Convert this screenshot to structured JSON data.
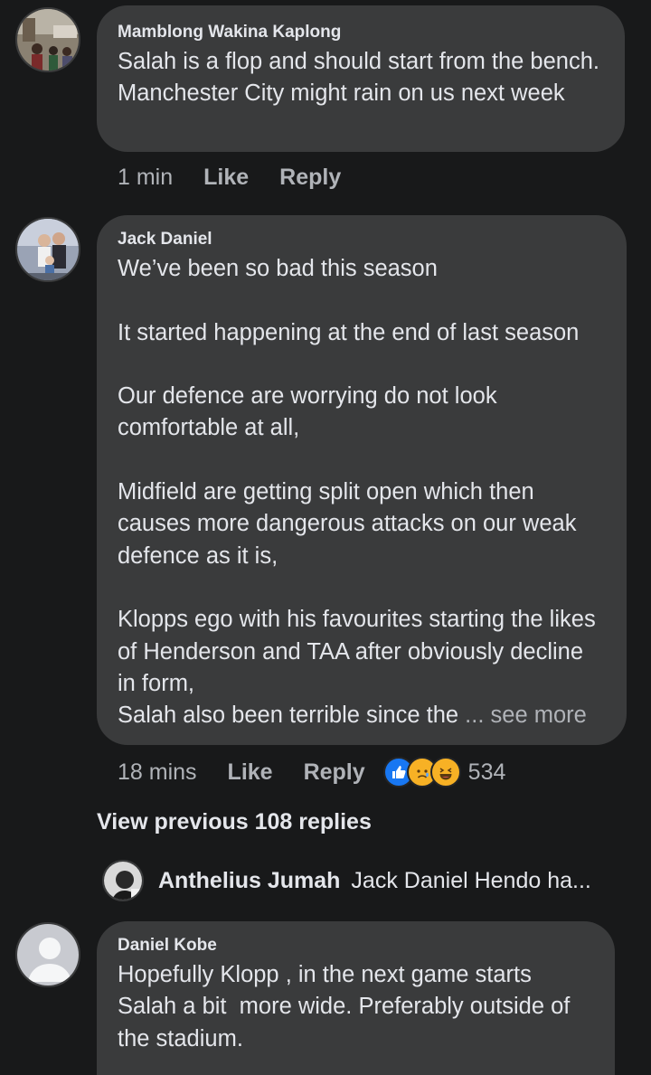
{
  "comments": [
    {
      "author": "Mamblong Wakina Kaplong",
      "text": "Salah is a flop and should start from the bench. Manchester City might rain on us next week",
      "time": "1 min",
      "like_label": "Like",
      "reply_label": "Reply"
    },
    {
      "author": "Jack Daniel",
      "text": "We’ve been so bad this season\n\nIt started happening at the end of last season\n\nOur defence are worrying do not look comfortable at all,\n\nMidfield are getting split open which then causes more dangerous attacks on our weak defence as it is,\n\nKlopps ego with his favourites starting the likes of Henderson and TAA after obviously decline in form,\nSalah also been terrible since the",
      "see_more": "... see more",
      "time": "18 mins",
      "like_label": "Like",
      "reply_label": "Reply",
      "reactions": [
        "like-icon",
        "sad-icon",
        "haha-icon"
      ],
      "reaction_count": "534"
    },
    {
      "author": "Daniel Kobe",
      "text": "Hopefully Klopp , in the next game starts Salah a bit  more wide. Preferably outside of the stadium."
    }
  ],
  "view_previous": "View previous 108 replies",
  "reply_preview": {
    "author": "Anthelius Jumah",
    "snippet": "Jack Daniel Hendo ha..."
  },
  "colors": {
    "background": "#18191a",
    "bubble": "#3a3b3c",
    "text": "#e4e6eb",
    "secondary_text": "#b0b3b8",
    "like_blue": "#1877f2",
    "reaction_yellow": "#f7b125"
  }
}
